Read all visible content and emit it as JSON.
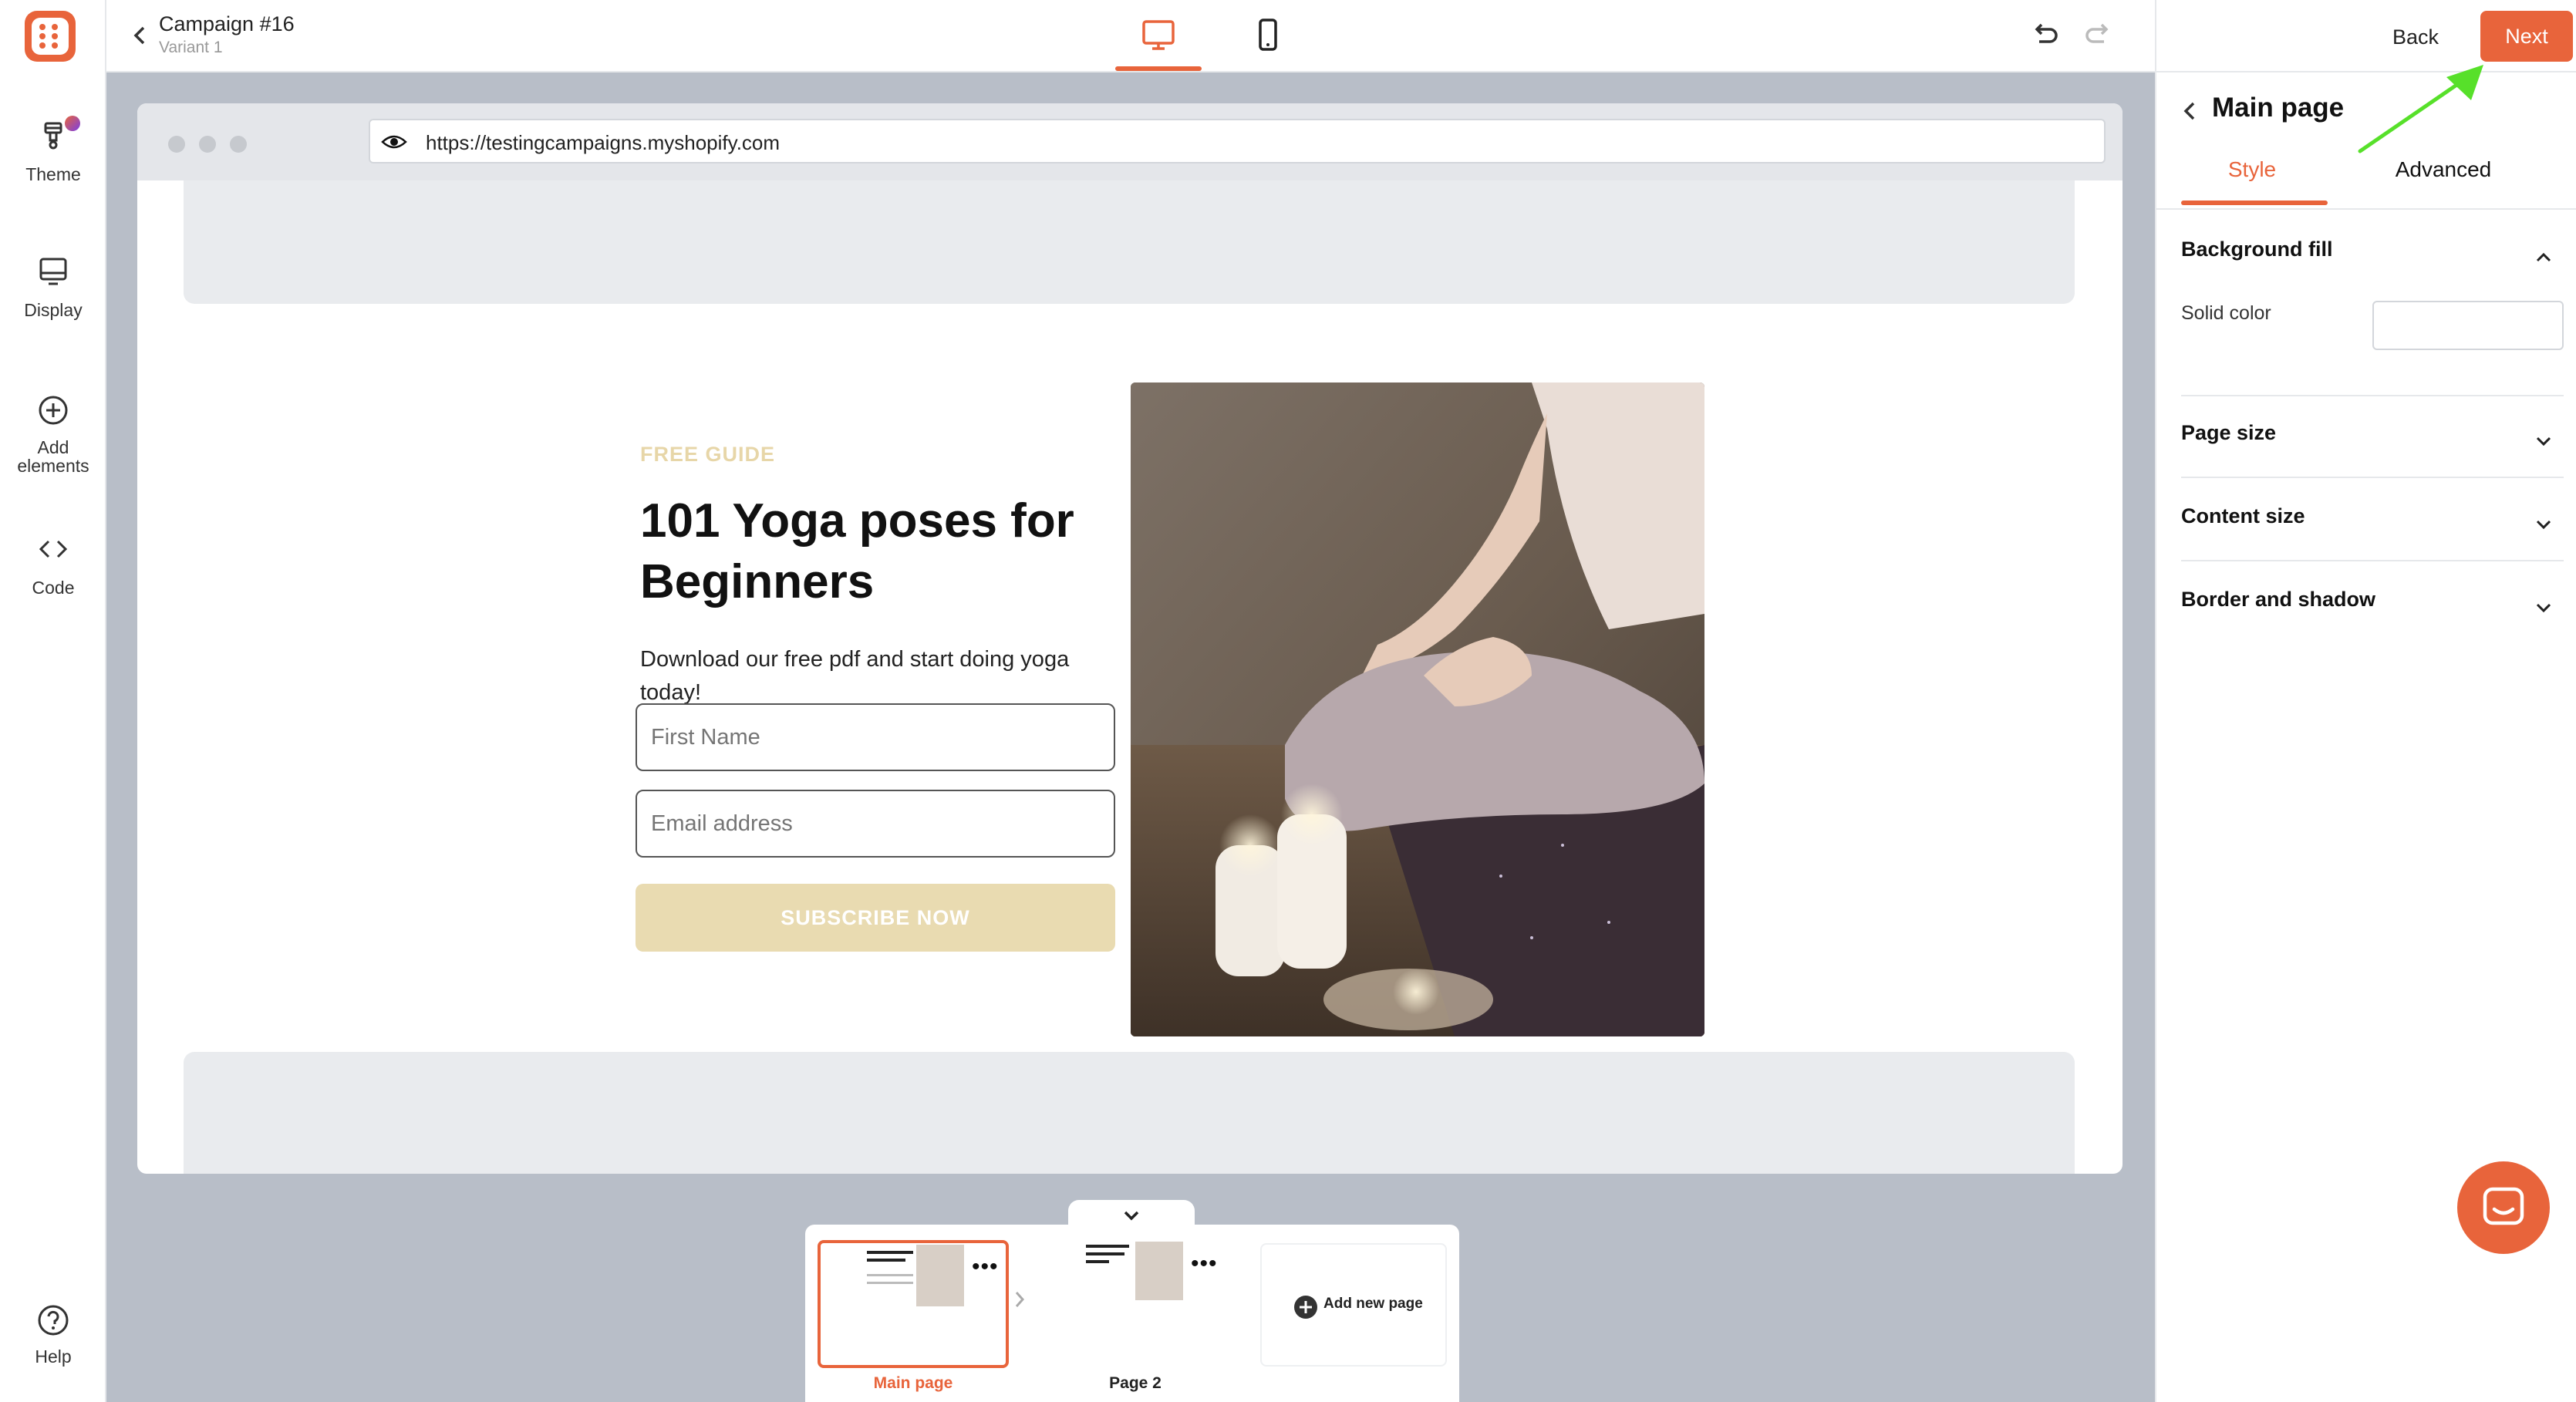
{
  "app": {
    "campaign_title": "Campaign #16",
    "variant": "Variant 1"
  },
  "sidebar": {
    "items": [
      {
        "label": "Theme",
        "icon": "theme-brush-icon"
      },
      {
        "label": "Display",
        "icon": "monitor-icon"
      },
      {
        "label": "Add elements",
        "icon": "plus-circle-icon"
      },
      {
        "label": "Code",
        "icon": "code-brackets-icon"
      }
    ],
    "help_label": "Help"
  },
  "toolbar": {
    "back_label": "Back",
    "next_label": "Next",
    "active_device": "desktop"
  },
  "browser": {
    "url": "https://testingcampaigns.myshopify.com"
  },
  "popup": {
    "eyebrow": "FREE GUIDE",
    "headline": "101 Yoga poses for Beginners",
    "description": "Download our free pdf and start doing yoga today!",
    "first_name_placeholder": "First Name",
    "email_placeholder": "Email address",
    "cta_label": "SUBSCRIBE NOW"
  },
  "pages": {
    "items": [
      {
        "label": "Main page",
        "active": true
      },
      {
        "label": "Page 2",
        "active": false
      }
    ],
    "add_label": "Add new page"
  },
  "settings": {
    "title": "Main page",
    "tabs": [
      {
        "label": "Style",
        "active": true
      },
      {
        "label": "Advanced",
        "active": false
      }
    ],
    "sections": [
      {
        "label": "Background fill",
        "expanded": true
      },
      {
        "label": "Page size",
        "expanded": false
      },
      {
        "label": "Content size",
        "expanded": false
      },
      {
        "label": "Border and shadow",
        "expanded": false
      }
    ],
    "solid_color_label": "Solid color"
  },
  "colors": {
    "accent": "#e8643b",
    "cta_bg": "#e9dbb1",
    "eyebrow": "#e7d6a8",
    "canvas_bg": "#b8bec8"
  }
}
